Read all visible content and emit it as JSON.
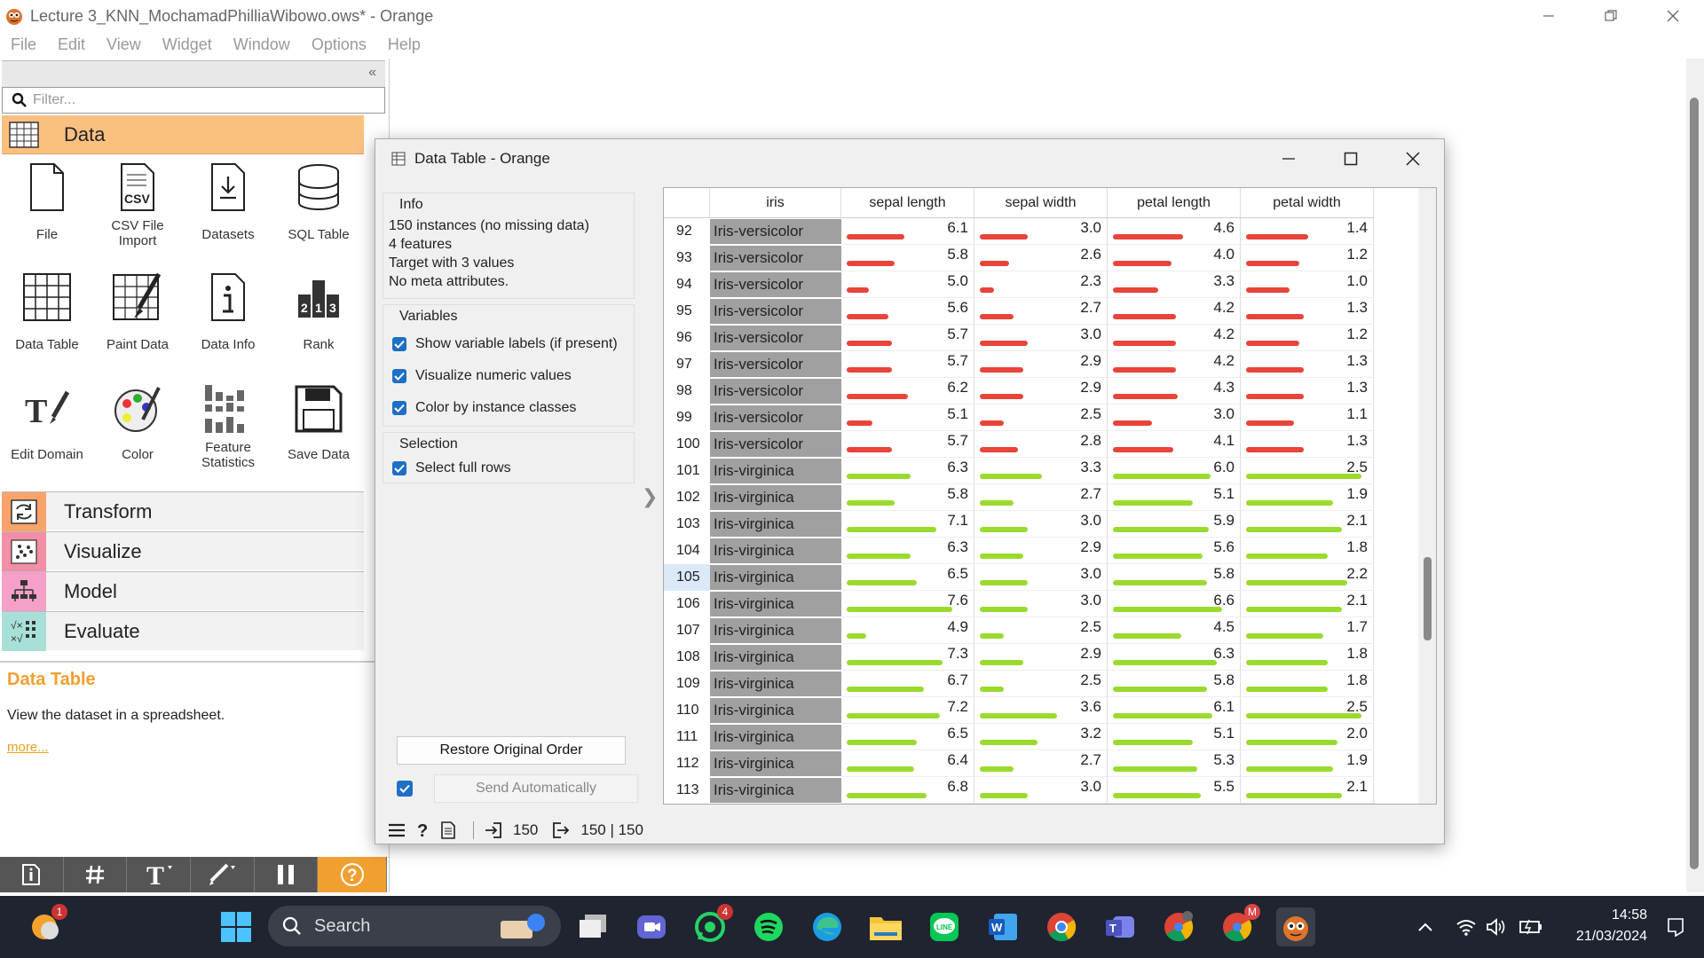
{
  "window": {
    "title": "Lecture 3_KNN_MochamadPhilliaWibowo.ows* - Orange"
  },
  "menu": [
    "File",
    "Edit",
    "View",
    "Widget",
    "Window",
    "Options",
    "Help"
  ],
  "toolbox": {
    "filter_placeholder": "Filter...",
    "collapse_glyph": "«",
    "data_category": "Data",
    "widgets": [
      {
        "label": "File",
        "icon": "file-icon"
      },
      {
        "label": "CSV File Import",
        "icon": "csv-icon"
      },
      {
        "label": "Datasets",
        "icon": "datasets-icon"
      },
      {
        "label": "SQL Table",
        "icon": "sql-icon"
      },
      {
        "label": "Data Table",
        "icon": "table-icon"
      },
      {
        "label": "Paint Data",
        "icon": "paint-icon"
      },
      {
        "label": "Data Info",
        "icon": "info-icon"
      },
      {
        "label": "Rank",
        "icon": "rank-icon"
      },
      {
        "label": "Edit Domain",
        "icon": "edit-domain-icon"
      },
      {
        "label": "Color",
        "icon": "palette-icon"
      },
      {
        "label": "Feature Statistics",
        "icon": "stats-icon"
      },
      {
        "label": "Save Data",
        "icon": "save-icon"
      }
    ],
    "categories": [
      {
        "label": "Transform",
        "color": "#f7a36a"
      },
      {
        "label": "Visualize",
        "color": "#f28ea5"
      },
      {
        "label": "Model",
        "color": "#f5a0c8"
      },
      {
        "label": "Evaluate",
        "color": "#a8e0d8"
      }
    ],
    "help": {
      "title": "Data Table",
      "desc": "View the dataset in a spreadsheet.",
      "more": "more..."
    }
  },
  "data_table": {
    "title": "Data Table - Orange",
    "info": {
      "title": "Info",
      "lines": [
        "150 instances (no missing data)",
        "4  features",
        "Target with 3 values",
        "No meta attributes."
      ]
    },
    "variables": {
      "title": "Variables",
      "options": [
        "Show variable labels (if present)",
        "Visualize numeric values",
        "Color by instance classes"
      ]
    },
    "selection": {
      "title": "Selection",
      "options": [
        "Select full rows"
      ]
    },
    "restore_label": "Restore Original Order",
    "send_label": "Send Automatically",
    "status": {
      "in": "150",
      "out": "150 | 150"
    },
    "columns": [
      "iris",
      "sepal length",
      "sepal width",
      "petal length",
      "petal width"
    ],
    "selected_row": 105,
    "colors": {
      "versicolor": "#e8443a",
      "virginica": "#9ada2e"
    },
    "rows": [
      {
        "n": 92,
        "cls": "Iris-versicolor",
        "v": [
          6.1,
          3.0,
          4.6,
          1.4
        ]
      },
      {
        "n": 93,
        "cls": "Iris-versicolor",
        "v": [
          5.8,
          2.6,
          4.0,
          1.2
        ]
      },
      {
        "n": 94,
        "cls": "Iris-versicolor",
        "v": [
          5.0,
          2.3,
          3.3,
          1.0
        ]
      },
      {
        "n": 95,
        "cls": "Iris-versicolor",
        "v": [
          5.6,
          2.7,
          4.2,
          1.3
        ]
      },
      {
        "n": 96,
        "cls": "Iris-versicolor",
        "v": [
          5.7,
          3.0,
          4.2,
          1.2
        ]
      },
      {
        "n": 97,
        "cls": "Iris-versicolor",
        "v": [
          5.7,
          2.9,
          4.2,
          1.3
        ]
      },
      {
        "n": 98,
        "cls": "Iris-versicolor",
        "v": [
          6.2,
          2.9,
          4.3,
          1.3
        ]
      },
      {
        "n": 99,
        "cls": "Iris-versicolor",
        "v": [
          5.1,
          2.5,
          3.0,
          1.1
        ]
      },
      {
        "n": 100,
        "cls": "Iris-versicolor",
        "v": [
          5.7,
          2.8,
          4.1,
          1.3
        ]
      },
      {
        "n": 101,
        "cls": "Iris-virginica",
        "v": [
          6.3,
          3.3,
          6.0,
          2.5
        ]
      },
      {
        "n": 102,
        "cls": "Iris-virginica",
        "v": [
          5.8,
          2.7,
          5.1,
          1.9
        ]
      },
      {
        "n": 103,
        "cls": "Iris-virginica",
        "v": [
          7.1,
          3.0,
          5.9,
          2.1
        ]
      },
      {
        "n": 104,
        "cls": "Iris-virginica",
        "v": [
          6.3,
          2.9,
          5.6,
          1.8
        ]
      },
      {
        "n": 105,
        "cls": "Iris-virginica",
        "v": [
          6.5,
          3.0,
          5.8,
          2.2
        ]
      },
      {
        "n": 106,
        "cls": "Iris-virginica",
        "v": [
          7.6,
          3.0,
          6.6,
          2.1
        ]
      },
      {
        "n": 107,
        "cls": "Iris-virginica",
        "v": [
          4.9,
          2.5,
          4.5,
          1.7
        ]
      },
      {
        "n": 108,
        "cls": "Iris-virginica",
        "v": [
          7.3,
          2.9,
          6.3,
          1.8
        ]
      },
      {
        "n": 109,
        "cls": "Iris-virginica",
        "v": [
          6.7,
          2.5,
          5.8,
          1.8
        ]
      },
      {
        "n": 110,
        "cls": "Iris-virginica",
        "v": [
          7.2,
          3.6,
          6.1,
          2.5
        ]
      },
      {
        "n": 111,
        "cls": "Iris-virginica",
        "v": [
          6.5,
          3.2,
          5.1,
          2.0
        ]
      },
      {
        "n": 112,
        "cls": "Iris-virginica",
        "v": [
          6.4,
          2.7,
          5.3,
          1.9
        ]
      },
      {
        "n": 113,
        "cls": "Iris-virginica",
        "v": [
          6.8,
          3.0,
          5.5,
          2.1
        ]
      }
    ]
  },
  "taskbar": {
    "search": "Search",
    "time": "14:58",
    "date": "21/03/2024",
    "badges": {
      "weather": "1",
      "whatsapp": "4",
      "chrome2": "M"
    }
  }
}
